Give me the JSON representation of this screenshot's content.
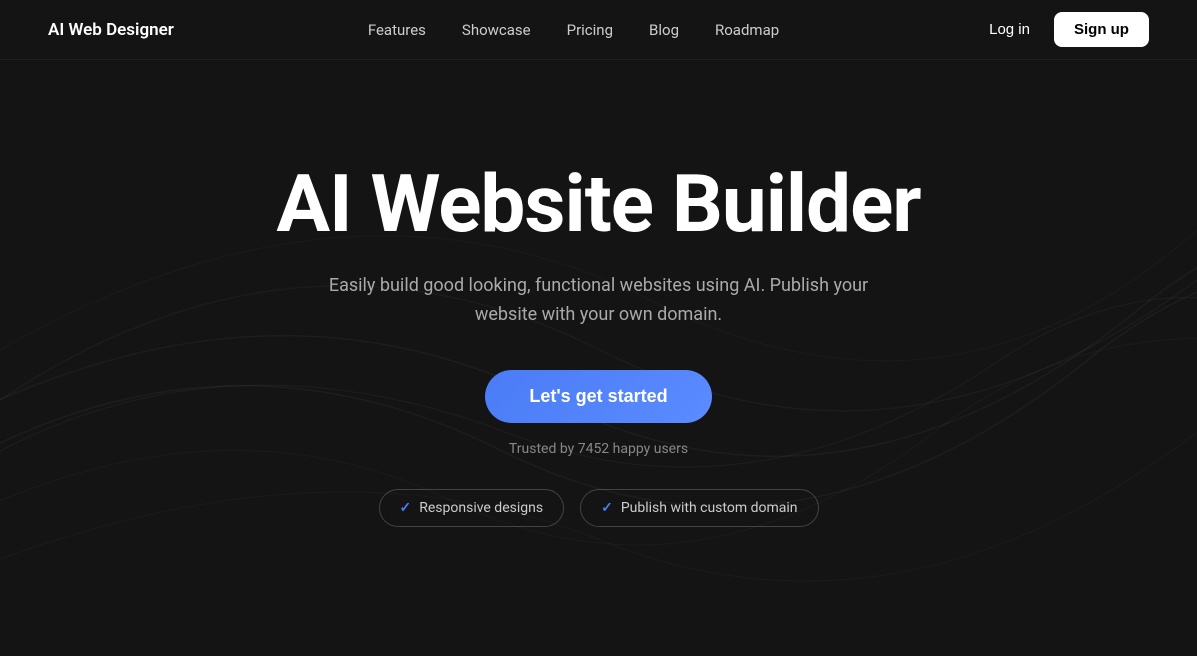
{
  "brand": {
    "name": "AI Web Designer"
  },
  "nav": {
    "links": [
      {
        "label": "Features",
        "id": "features"
      },
      {
        "label": "Showcase",
        "id": "showcase"
      },
      {
        "label": "Pricing",
        "id": "pricing"
      },
      {
        "label": "Blog",
        "id": "blog"
      },
      {
        "label": "Roadmap",
        "id": "roadmap"
      }
    ],
    "login_label": "Log in",
    "signup_label": "Sign up"
  },
  "hero": {
    "title": "AI Website Builder",
    "subtitle": "Easily build good looking, functional websites using AI. Publish your website with your own domain.",
    "cta_label": "Let's get started",
    "trusted_text": "Trusted by 7452 happy users"
  },
  "badges": [
    {
      "label": "Responsive designs",
      "check": "✓"
    },
    {
      "label": "Publish with custom domain",
      "check": "✓"
    }
  ],
  "colors": {
    "bg": "#141414",
    "accent": "#4f7ef7",
    "text_primary": "#ffffff",
    "text_secondary": "#aaaaaa"
  }
}
